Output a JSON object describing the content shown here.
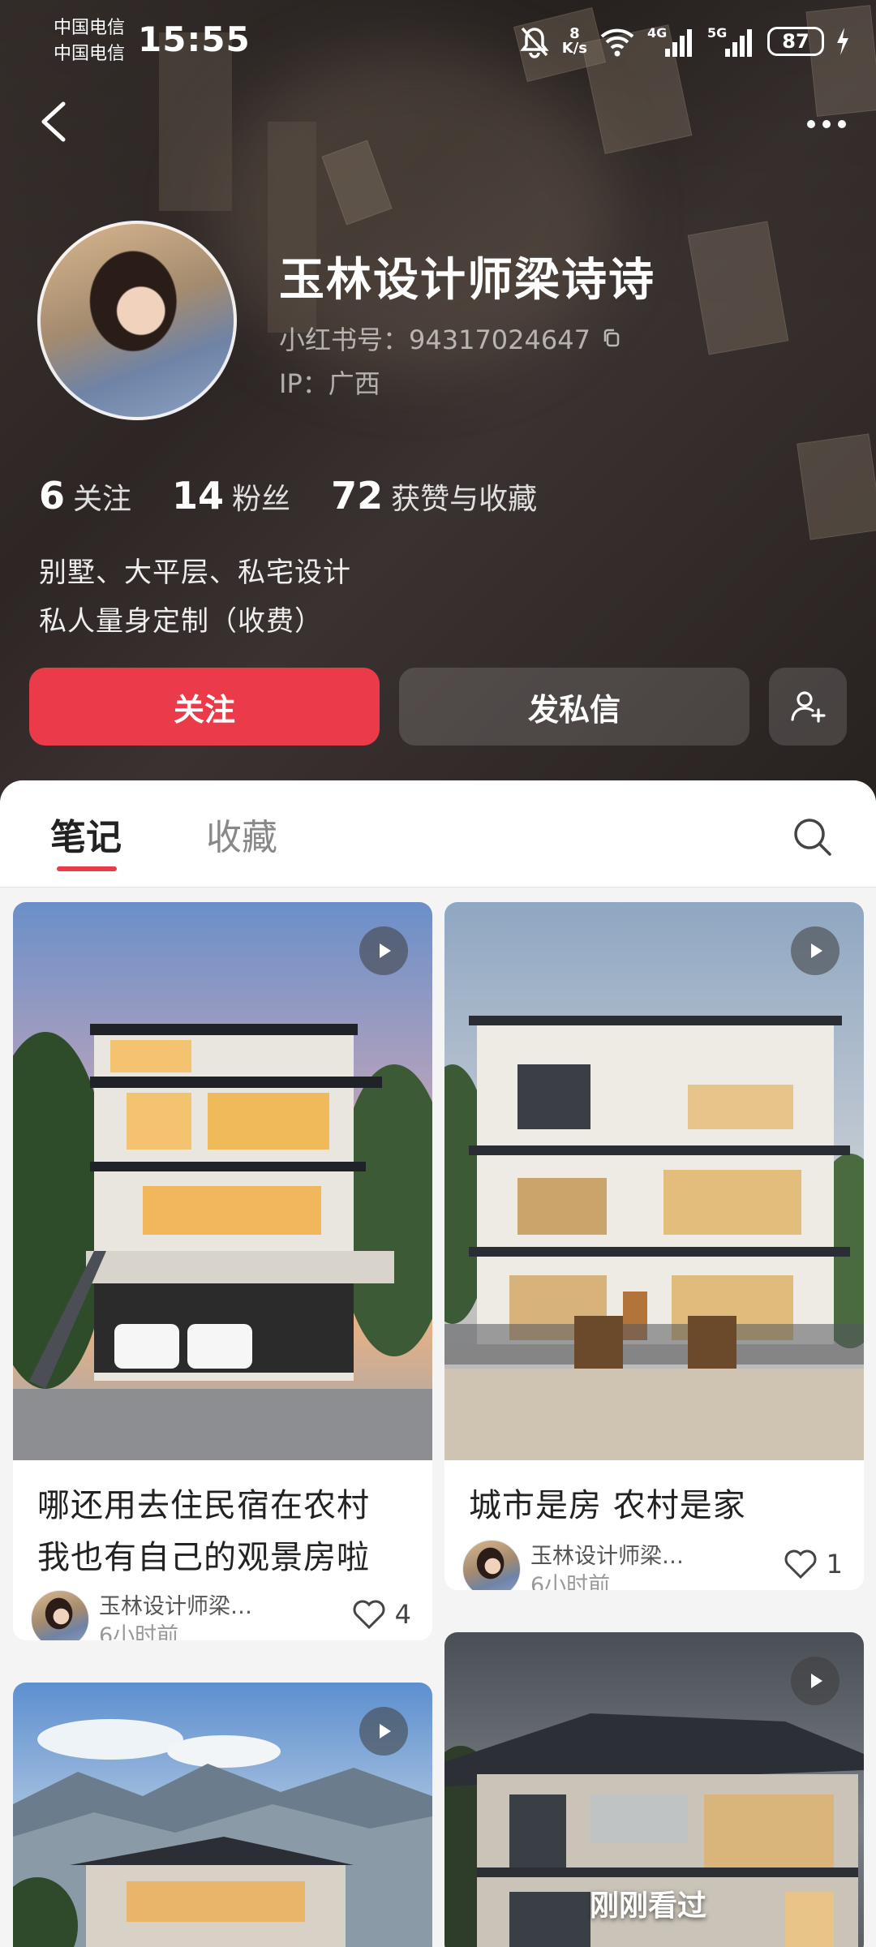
{
  "status_bar": {
    "carrier_1": "中国电信",
    "carrier_2": "中国电信",
    "time": "15:55",
    "net_speed_value": "8",
    "net_speed_unit": "K/s",
    "signal_1": "4G",
    "signal_2": "5G",
    "battery": "87"
  },
  "profile": {
    "name": "玉林设计师梁诗诗",
    "redbook_id": "小红书号：94317024647",
    "ip": "IP：广西",
    "stats": {
      "following_count": "6",
      "following_label": "关注",
      "followers_count": "14",
      "followers_label": "粉丝",
      "likes_count": "72",
      "likes_label": "获赞与收藏"
    },
    "bio_line_1": "别墅、大平层、私宅设计",
    "bio_line_2": "私人量身定制（收费）"
  },
  "actions": {
    "follow": "关注",
    "message": "发私信"
  },
  "tabs": {
    "notes": "笔记",
    "collections": "收藏"
  },
  "cards": [
    {
      "title_line_1": "哪还用去住民宿在农村",
      "title_line_2": "我也有自己的观景房啦",
      "author": "玉林设计师梁…",
      "time": "6小时前",
      "likes": "4"
    },
    {
      "title_line_1": "城市是房 农村是家",
      "author": "玉林设计师梁…",
      "time": "6小时前",
      "likes": "1"
    }
  ],
  "recent_overlay": "刚刚看过"
}
